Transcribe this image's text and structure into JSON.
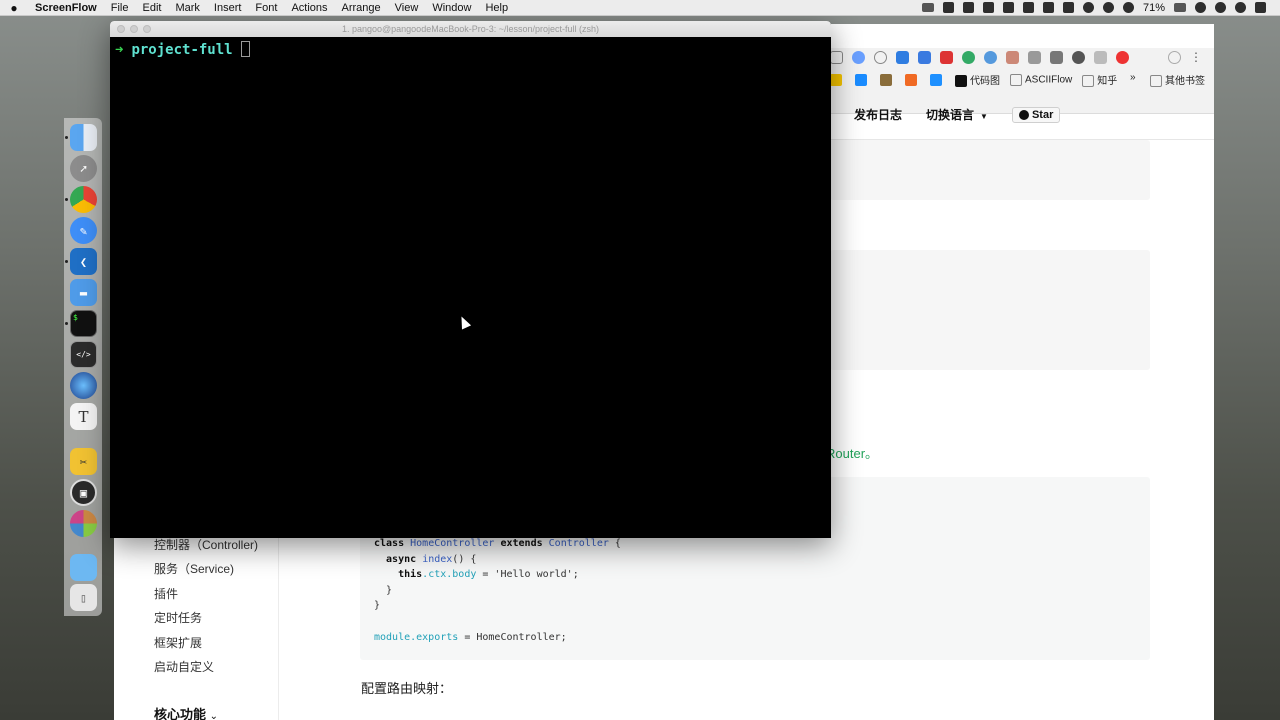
{
  "menubar": {
    "apple": "",
    "app_name": "ScreenFlow",
    "menus": [
      "File",
      "Edit",
      "Mark",
      "Insert",
      "Font",
      "Actions",
      "Arrange",
      "View",
      "Window",
      "Help"
    ],
    "battery": "71%"
  },
  "terminal": {
    "title": "1. pangoo@pangoodeMacBook-Pro-3: ~/lesson/project-full (zsh)",
    "prompt_arrow": "➜",
    "prompt_dir": "project-full"
  },
  "browser": {
    "bookmarks": [
      "代码图",
      "ASCIIFlow",
      "知乎"
    ],
    "bookmarks_more": "»",
    "other_bookmarks": "其他书签",
    "menu_dots": "⋮",
    "nav": {
      "changelog": "发布日志",
      "language": "切换语言",
      "language_caret": "▼",
      "star": "Star"
    },
    "router_text": "Router。",
    "sidebar": {
      "items": [
        "控制器（Controller)",
        "服务（Service)",
        "插件",
        "定时任务",
        "框架扩展",
        "启动自定义"
      ],
      "heading": "核心功能",
      "heading_caret": "⌄"
    },
    "code": {
      "line1_kw": "class",
      "line1_cls": "HomeController",
      "line1_ext": "extends",
      "line1_base": "Controller",
      "line1_brace": " {",
      "line2_kw": "  async",
      "line2_fn": "index",
      "line2_rest": "() {",
      "line3_kw": "    this",
      "line3_ctx": ".ctx.body",
      "line3_rest": " = 'Hello world';",
      "line4": "  }",
      "line5": "}",
      "line7_mod": "module.exports",
      "line7_rest": " = HomeController;"
    },
    "section_label": "配置路由映射："
  },
  "dock": {
    "apps": [
      "finder",
      "launchpad",
      "chrome",
      "pencil-app",
      "vscode",
      "keynote",
      "terminal",
      "script-editor",
      "quicktime",
      "typora",
      "screenflow-tools",
      "screenshot",
      "final-cut",
      "folder",
      "trash"
    ]
  }
}
